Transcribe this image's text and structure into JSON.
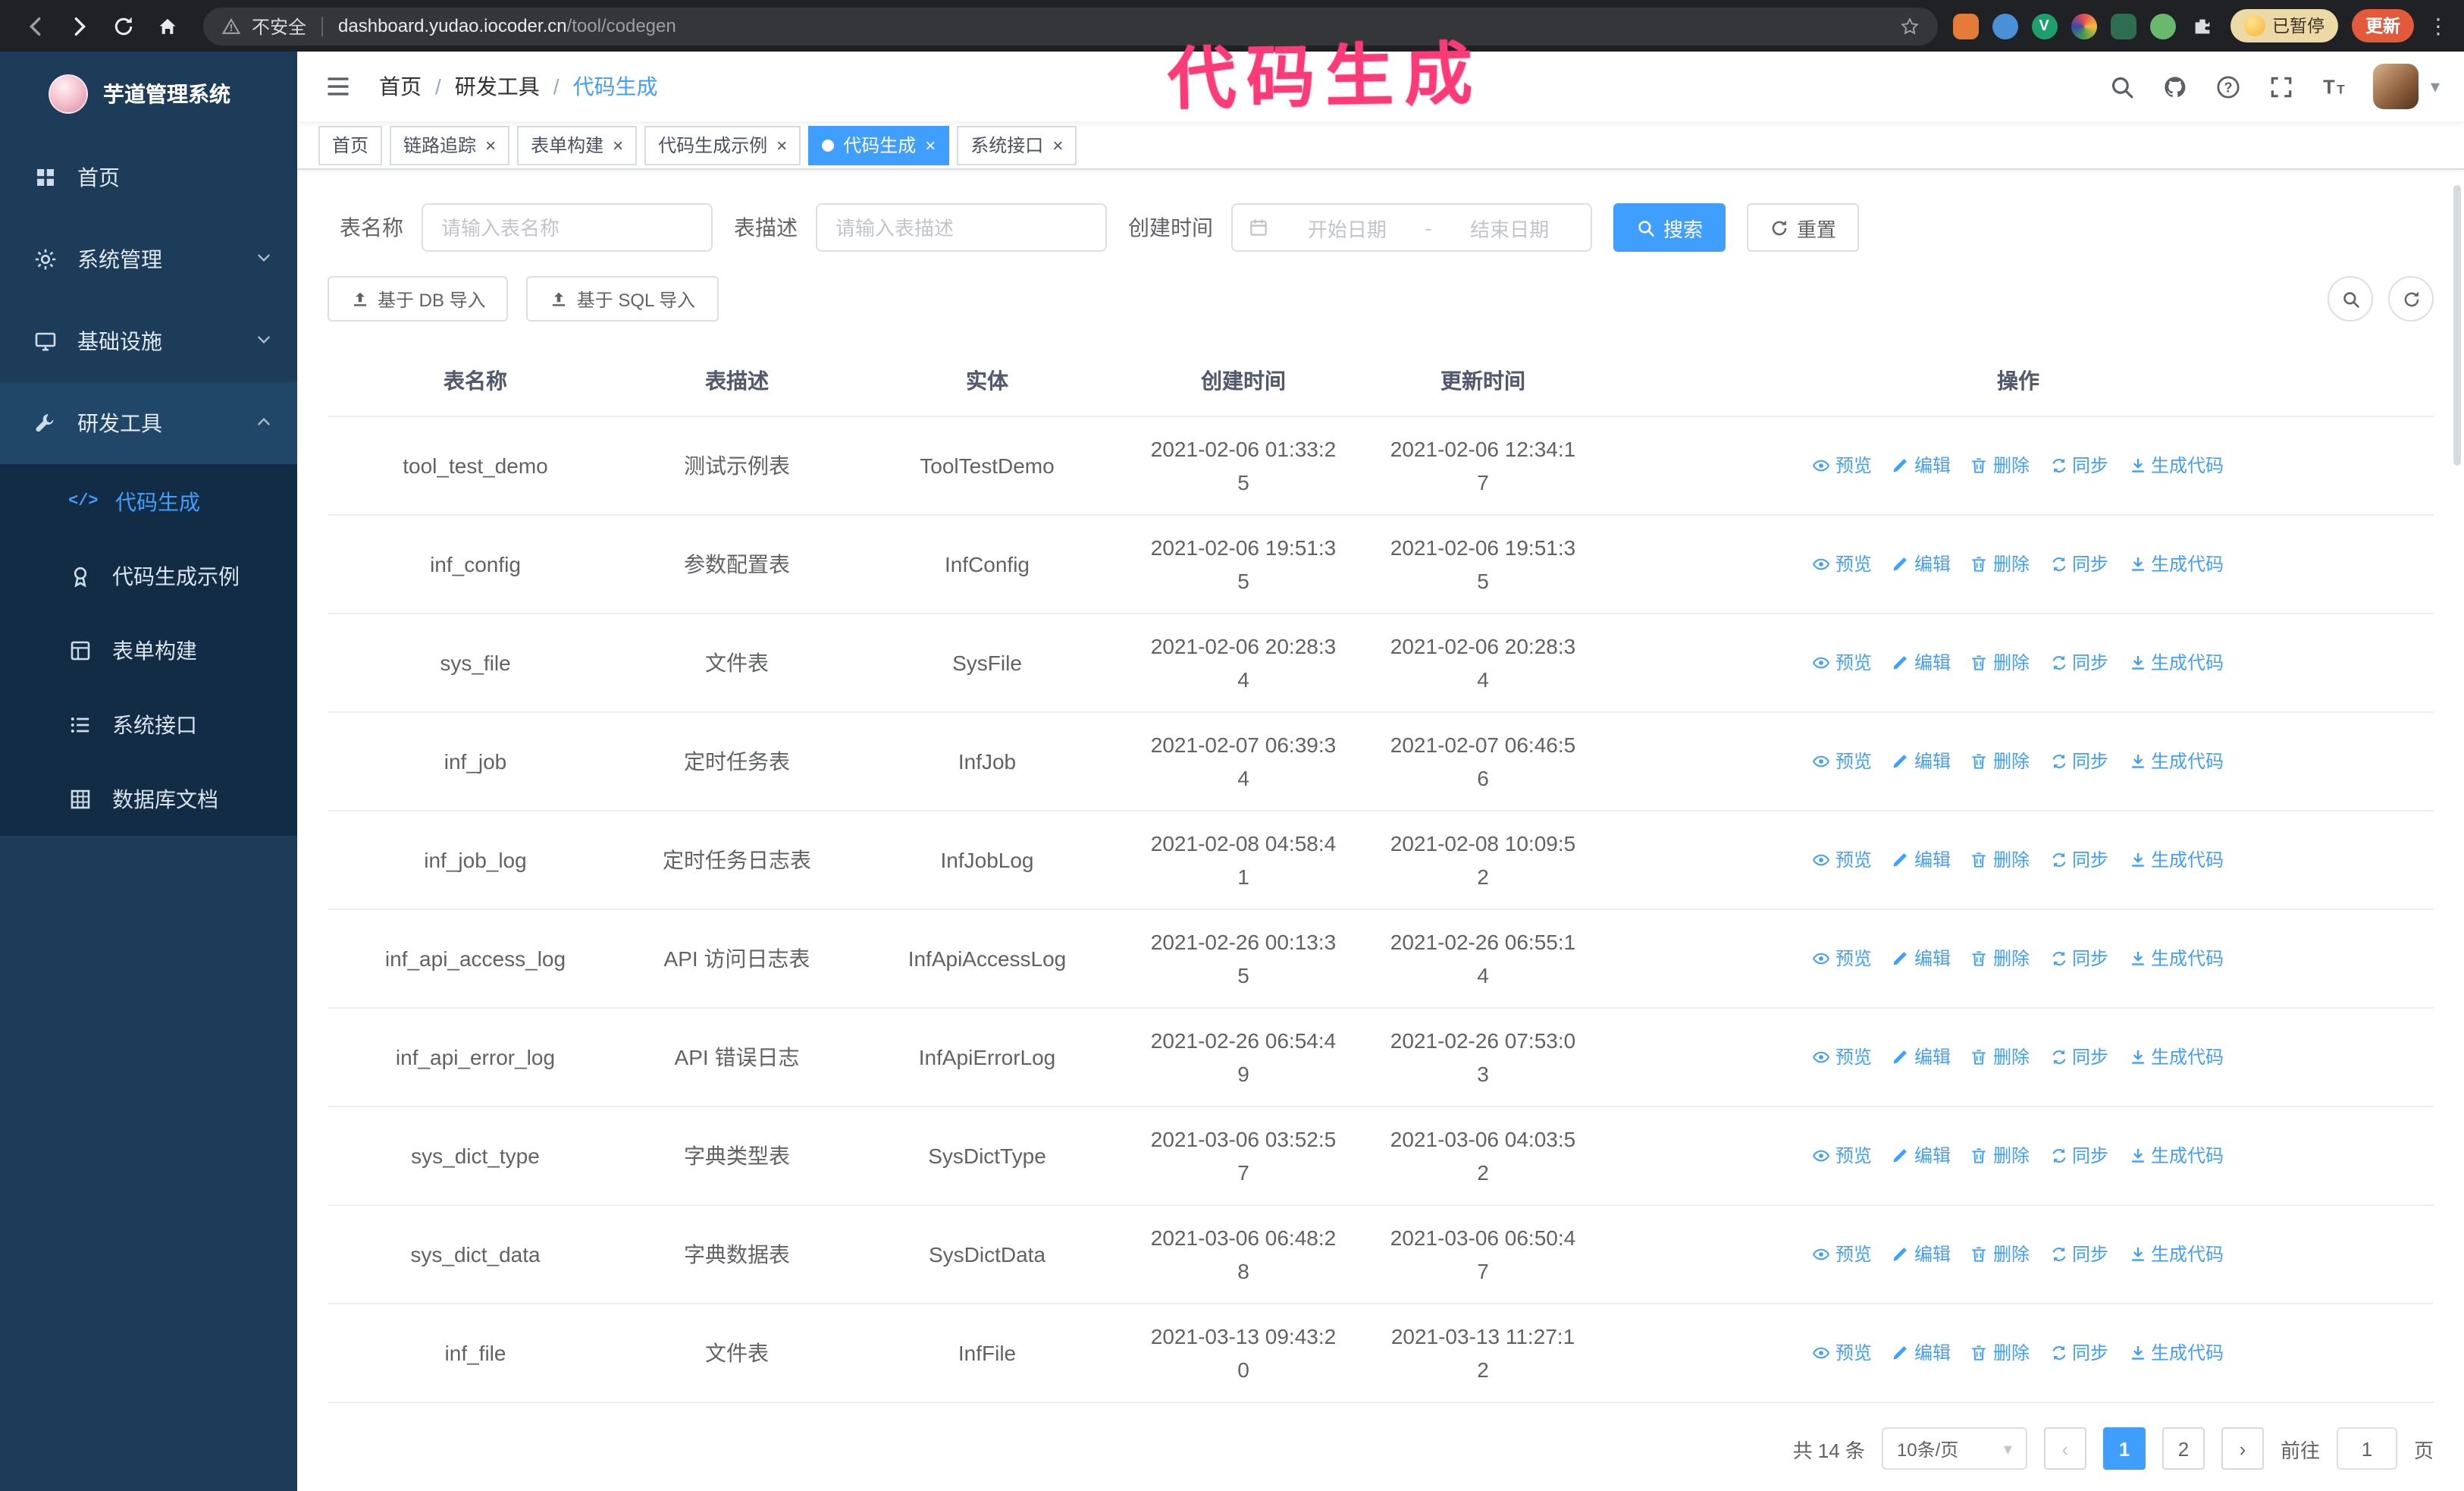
{
  "theme": {
    "accent": "#409eff",
    "annotation": "#fb3b77",
    "sidebar_bg": "#1c3c59",
    "sidebar_sub_bg": "#122c45",
    "sidebar_active_bg": "#204767",
    "chrome_bg": "#202124"
  },
  "annotation": {
    "text": "代码生成"
  },
  "browser": {
    "security_warning": "不安全",
    "url_domain": "dashboard.yudao.iocoder.cn",
    "url_path": "/tool/codegen",
    "paused_label": "已暂停",
    "update_label": "更新"
  },
  "icons": {
    "close": "×",
    "more_vert": "⋮",
    "caret_down": "▾",
    "code_tag": "</>",
    "chevron_left": "‹",
    "chevron_right": "›"
  },
  "sidebar": {
    "logo_title": "芋道管理系统",
    "items": [
      {
        "label": "首页",
        "icon": "dashboard"
      },
      {
        "label": "系统管理",
        "icon": "gear",
        "expandable": true
      },
      {
        "label": "基础设施",
        "icon": "monitor",
        "expandable": true
      },
      {
        "label": "研发工具",
        "icon": "wrench",
        "expanded": true
      }
    ],
    "subitems": [
      {
        "label": "代码生成",
        "icon": "code-tag",
        "active": true
      },
      {
        "label": "代码生成示例",
        "icon": "medal"
      },
      {
        "label": "表单构建",
        "icon": "form"
      },
      {
        "label": "系统接口",
        "icon": "api-list"
      },
      {
        "label": "数据库文档",
        "icon": "db-grid"
      }
    ]
  },
  "navbar": {
    "breadcrumb": [
      "首页",
      "研发工具",
      "代码生成"
    ],
    "separator": "/"
  },
  "tabs": [
    {
      "label": "首页",
      "closable": false,
      "active": false
    },
    {
      "label": "链路追踪",
      "closable": true,
      "active": false
    },
    {
      "label": "表单构建",
      "closable": true,
      "active": false
    },
    {
      "label": "代码生成示例",
      "closable": true,
      "active": false
    },
    {
      "label": "代码生成",
      "closable": true,
      "active": true
    },
    {
      "label": "系统接口",
      "closable": true,
      "active": false
    }
  ],
  "filters": {
    "table_name_label": "表名称",
    "table_name_placeholder": "请输入表名称",
    "table_desc_label": "表描述",
    "table_desc_placeholder": "请输入表描述",
    "create_time_label": "创建时间",
    "date_start_placeholder": "开始日期",
    "date_separator": "-",
    "date_end_placeholder": "结束日期",
    "search_label": "搜索",
    "reset_label": "重置"
  },
  "toolbar": {
    "import_db_label": "基于 DB 导入",
    "import_sql_label": "基于 SQL 导入"
  },
  "table": {
    "columns": [
      "表名称",
      "表描述",
      "实体",
      "创建时间",
      "更新时间",
      "操作"
    ],
    "actions": [
      {
        "key": "preview",
        "icon": "eye",
        "label": "预览"
      },
      {
        "key": "edit",
        "icon": "pencil",
        "label": "编辑"
      },
      {
        "key": "delete",
        "icon": "trash",
        "label": "删除"
      },
      {
        "key": "sync",
        "icon": "sync",
        "label": "同步"
      },
      {
        "key": "generate",
        "icon": "download",
        "label": "生成代码"
      }
    ],
    "rows": [
      {
        "name": "tool_test_demo",
        "desc": "测试示例表",
        "entity": "ToolTestDemo",
        "created": "2021-02-06 01:33:25",
        "updated": "2021-02-06 12:34:17"
      },
      {
        "name": "inf_config",
        "desc": "参数配置表",
        "entity": "InfConfig",
        "created": "2021-02-06 19:51:35",
        "updated": "2021-02-06 19:51:35"
      },
      {
        "name": "sys_file",
        "desc": "文件表",
        "entity": "SysFile",
        "created": "2021-02-06 20:28:34",
        "updated": "2021-02-06 20:28:34"
      },
      {
        "name": "inf_job",
        "desc": "定时任务表",
        "entity": "InfJob",
        "created": "2021-02-07 06:39:34",
        "updated": "2021-02-07 06:46:56"
      },
      {
        "name": "inf_job_log",
        "desc": "定时任务日志表",
        "entity": "InfJobLog",
        "created": "2021-02-08 04:58:41",
        "updated": "2021-02-08 10:09:52"
      },
      {
        "name": "inf_api_access_log",
        "desc": "API 访问日志表",
        "entity": "InfApiAccessLog",
        "created": "2021-02-26 00:13:35",
        "updated": "2021-02-26 06:55:14"
      },
      {
        "name": "inf_api_error_log",
        "desc": "API 错误日志",
        "entity": "InfApiErrorLog",
        "created": "2021-02-26 06:54:49",
        "updated": "2021-02-26 07:53:03"
      },
      {
        "name": "sys_dict_type",
        "desc": "字典类型表",
        "entity": "SysDictType",
        "created": "2021-03-06 03:52:57",
        "updated": "2021-03-06 04:03:52"
      },
      {
        "name": "sys_dict_data",
        "desc": "字典数据表",
        "entity": "SysDictData",
        "created": "2021-03-06 06:48:28",
        "updated": "2021-03-06 06:50:47"
      },
      {
        "name": "inf_file",
        "desc": "文件表",
        "entity": "InfFile",
        "created": "2021-03-13 09:43:20",
        "updated": "2021-03-13 11:27:12"
      }
    ]
  },
  "pagination": {
    "total_text": "共 14 条",
    "page_size_label": "10条/页",
    "pages": [
      "1",
      "2"
    ],
    "active_page": "1",
    "goto_label": "前往",
    "goto_value": "1",
    "goto_suffix": "页"
  }
}
